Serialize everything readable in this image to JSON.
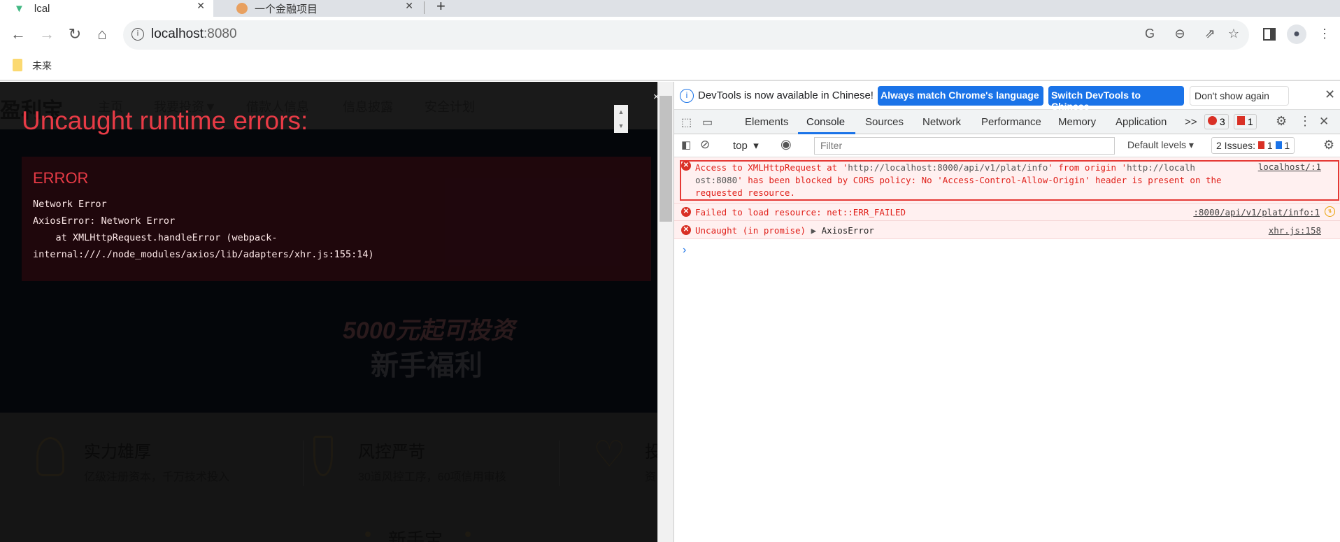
{
  "browser": {
    "tabs": [
      {
        "title": "lcal"
      },
      {
        "title": "一个金融项目"
      }
    ],
    "new_tab": "+",
    "url_host": "localhost",
    "url_port": ":8080",
    "bookmarks": [
      {
        "label": "未来"
      }
    ]
  },
  "page": {
    "logo": "盈利宝",
    "nav": [
      "主页",
      "我要投资▼",
      "借款人信息",
      "信息披露",
      "安全计划"
    ],
    "banner": {
      "line1": "5000元起可投资",
      "line2": "新手福利"
    },
    "features": [
      {
        "title": "实力雄厚",
        "desc": "亿级注册资本，千万技术投入"
      },
      {
        "title": "风控严苛",
        "desc": "30道风控工序，60项信用审核"
      },
      {
        "title": "投",
        "desc": "资"
      }
    ],
    "section_title": "新手宝"
  },
  "overlay": {
    "title": "Uncaught runtime errors:",
    "close": "×",
    "error_heading": "ERROR",
    "lines": [
      "Network Error",
      "AxiosError: Network Error",
      "    at XMLHttpRequest.handleError (webpack-",
      "internal:///./node_modules/axios/lib/adapters/xhr.js:155:14)"
    ]
  },
  "devtools": {
    "infobar": {
      "text": "DevTools is now available in Chinese!",
      "btn1": "Always match Chrome's language",
      "btn2": "Switch DevTools to Chinese",
      "btn3": "Don't show again"
    },
    "tabs": [
      "Elements",
      "Console",
      "Sources",
      "Network",
      "Performance",
      "Memory",
      "Application"
    ],
    "active_tab": "Console",
    "more": ">>",
    "error_count": "3",
    "issue_count": "1",
    "context": "top",
    "filter_placeholder": "Filter",
    "levels": "Default levels ▾",
    "issues_label": "2 Issues:",
    "issues_red": "1",
    "issues_blue": "1",
    "messages": [
      {
        "parts": [
          "Access to XMLHttpRequest at '",
          "http://localhost:8000/api/v1/plat/info",
          "' from origin '",
          "http://localh",
          "ost:8080",
          "' has been blocked by CORS policy: No 'Access-Control-Allow-Origin' header is present on the",
          "requested resource."
        ],
        "source": "localhost/:1"
      },
      {
        "text": "Failed to load resource: net::ERR_FAILED",
        "source": ":8000/api/v1/plat/info:1"
      },
      {
        "text": "Uncaught (in promise) ",
        "object": "AxiosError",
        "source": "xhr.js:158"
      }
    ],
    "prompt": "›"
  },
  "colors": {
    "error": "#e83b46",
    "accent": "#1a73e8"
  }
}
